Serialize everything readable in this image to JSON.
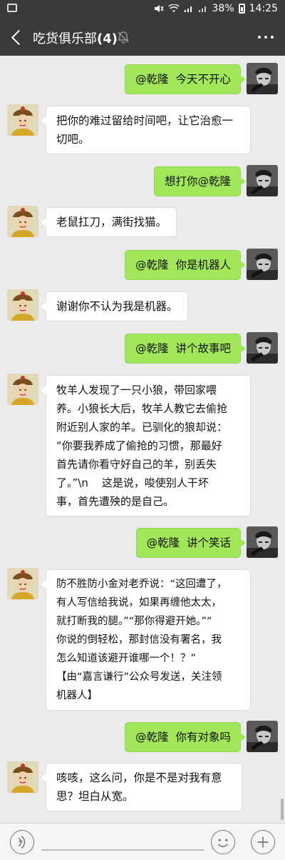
{
  "status_bar": {
    "battery": "38%",
    "time": "14:25"
  },
  "header": {
    "title": "吃货俱乐部",
    "count": "(4)"
  },
  "messages": [
    {
      "side": "right",
      "text": "@乾隆  今天不开心"
    },
    {
      "side": "left",
      "text": "把你的难过留给时间吧，让它治愈一\n切吧。"
    },
    {
      "side": "right",
      "text": "想打你@乾隆"
    },
    {
      "side": "left",
      "text": "老鼠扛刀，满街找猫。"
    },
    {
      "side": "right",
      "text": "@乾隆  你是机器人"
    },
    {
      "side": "left",
      "text": "谢谢你不认为我是机器。"
    },
    {
      "side": "right",
      "text": "@乾隆  讲个故事吧"
    },
    {
      "side": "left",
      "text": "牧羊人发现了一只小狼，带回家喂\n养。小狼长大后，牧羊人教它去偷抢\n附近别人家的羊。已驯化的狼却说：\n“你要我养成了偷抢的习惯，那最好\n首先请你看守好自己的羊，别丢失\n了。”\\n    这是说，唆使别人干坏\n事，首先遭殃的是自己。"
    },
    {
      "side": "right",
      "text": "@乾隆  讲个笑话"
    },
    {
      "side": "left",
      "text": "防不胜防小金对老乔说：“这回遭了，\n有人写信给我说，如果再缠他太太，\n就打断我的腿。”“那你得避开她。”“\n你说的倒轻松，那封信没有署名，我\n怎么知道该避开谁哪一个！？”\n【由“嘉言谦行”公众号发送，关注领\n机器人】"
    },
    {
      "side": "right",
      "text": "@乾隆  你有对象吗"
    },
    {
      "side": "left",
      "text": "咳咳，这么问，你是不是对我有意\n思？坦白从宽。"
    }
  ],
  "icons": {
    "back": "back-arrow-icon",
    "mute": "mute-bell-icon",
    "more": "more-icon",
    "voice": "voice-icon",
    "emoji": "emoji-icon",
    "plus": "plus-icon"
  },
  "colors": {
    "bar": "#3a3a3a",
    "chat_bg": "#ebebeb",
    "bubble_self": "#a0e75a",
    "bubble_other": "#ffffff"
  }
}
